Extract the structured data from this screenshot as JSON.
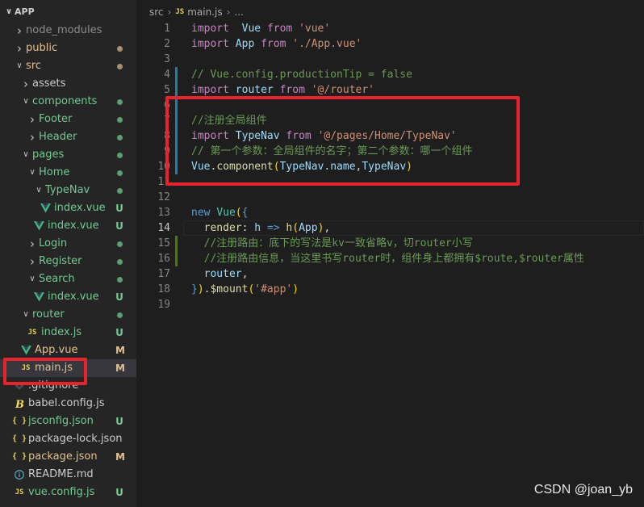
{
  "explorer": {
    "root_label": "APP",
    "items": [
      {
        "label": "node_modules",
        "kind": "folder",
        "expanded": false,
        "depth": 0,
        "color": "gray",
        "badge": ""
      },
      {
        "label": "public",
        "kind": "folder",
        "expanded": false,
        "depth": 0,
        "color": "tan",
        "badge": "dot-tan"
      },
      {
        "label": "src",
        "kind": "folder",
        "expanded": true,
        "depth": 0,
        "color": "tan",
        "badge": "dot-tan"
      },
      {
        "label": "assets",
        "kind": "folder",
        "expanded": false,
        "depth": 1,
        "color": "",
        "badge": ""
      },
      {
        "label": "components",
        "kind": "folder",
        "expanded": true,
        "depth": 1,
        "color": "green",
        "badge": "dot-green"
      },
      {
        "label": "Footer",
        "kind": "folder",
        "expanded": false,
        "depth": 2,
        "color": "green",
        "badge": "dot-green"
      },
      {
        "label": "Header",
        "kind": "folder",
        "expanded": false,
        "depth": 2,
        "color": "green",
        "badge": "dot-green"
      },
      {
        "label": "pages",
        "kind": "folder",
        "expanded": true,
        "depth": 1,
        "color": "green",
        "badge": "dot-green"
      },
      {
        "label": "Home",
        "kind": "folder",
        "expanded": true,
        "depth": 2,
        "color": "green",
        "badge": "dot-green"
      },
      {
        "label": "TypeNav",
        "kind": "folder",
        "expanded": true,
        "depth": 3,
        "color": "green",
        "badge": "dot-green"
      },
      {
        "label": "index.vue",
        "kind": "vue",
        "depth": 4,
        "color": "green",
        "badge": "U"
      },
      {
        "label": "index.vue",
        "kind": "vue",
        "depth": 3,
        "color": "green",
        "badge": "U"
      },
      {
        "label": "Login",
        "kind": "folder",
        "expanded": false,
        "depth": 2,
        "color": "green",
        "badge": "dot-green"
      },
      {
        "label": "Register",
        "kind": "folder",
        "expanded": false,
        "depth": 2,
        "color": "green",
        "badge": "dot-green"
      },
      {
        "label": "Search",
        "kind": "folder",
        "expanded": true,
        "depth": 2,
        "color": "green",
        "badge": "dot-green"
      },
      {
        "label": "index.vue",
        "kind": "vue",
        "depth": 3,
        "color": "green",
        "badge": "U"
      },
      {
        "label": "router",
        "kind": "folder",
        "expanded": true,
        "depth": 1,
        "color": "green",
        "badge": "dot-green"
      },
      {
        "label": "index.js",
        "kind": "js",
        "depth": 2,
        "color": "green",
        "badge": "U"
      },
      {
        "label": "App.vue",
        "kind": "vue",
        "depth": 1,
        "color": "tan",
        "badge": "M"
      },
      {
        "label": "main.js",
        "kind": "js",
        "depth": 1,
        "color": "tan",
        "badge": "M",
        "selected": true
      },
      {
        "label": ".gitignore",
        "kind": "git",
        "depth": 0,
        "color": "",
        "badge": ""
      },
      {
        "label": "babel.config.js",
        "kind": "babel",
        "depth": 0,
        "color": "",
        "badge": ""
      },
      {
        "label": "jsconfig.json",
        "kind": "json",
        "depth": 0,
        "color": "green",
        "badge": "U"
      },
      {
        "label": "package-lock.json",
        "kind": "json",
        "depth": 0,
        "color": "",
        "badge": ""
      },
      {
        "label": "package.json",
        "kind": "json",
        "depth": 0,
        "color": "tan",
        "badge": "M"
      },
      {
        "label": "README.md",
        "kind": "info",
        "depth": 0,
        "color": "",
        "badge": ""
      },
      {
        "label": "vue.config.js",
        "kind": "js",
        "depth": 0,
        "color": "green",
        "badge": "U"
      }
    ]
  },
  "breadcrumb": {
    "folder": "src",
    "file": "main.js",
    "tail": "...",
    "js_badge": "JS"
  },
  "editor": {
    "active_line": 14,
    "lines": [
      {
        "n": "1",
        "tokens": [
          [
            "kw",
            "import"
          ],
          [
            "",
            "  "
          ],
          [
            "var",
            "Vue"
          ],
          [
            "",
            " "
          ],
          [
            "kw",
            "from"
          ],
          [
            "",
            " "
          ],
          [
            "str",
            "'vue'"
          ]
        ]
      },
      {
        "n": "2",
        "tokens": [
          [
            "kw",
            "import"
          ],
          [
            "",
            " "
          ],
          [
            "var",
            "App"
          ],
          [
            "",
            " "
          ],
          [
            "kw",
            "from"
          ],
          [
            "",
            " "
          ],
          [
            "str",
            "'./App.vue'"
          ]
        ]
      },
      {
        "n": "3",
        "tokens": []
      },
      {
        "n": "4",
        "tokens": [
          [
            "cm",
            "// Vue.config.productionTip = false"
          ]
        ],
        "mark": "blue"
      },
      {
        "n": "5",
        "tokens": [
          [
            "kw",
            "import"
          ],
          [
            "",
            " "
          ],
          [
            "var",
            "router"
          ],
          [
            "",
            " "
          ],
          [
            "kw",
            "from"
          ],
          [
            "",
            " "
          ],
          [
            "str",
            "'@/router'"
          ]
        ],
        "mark": "blue"
      },
      {
        "n": "6",
        "tokens": [],
        "mark": "blue"
      },
      {
        "n": "7",
        "tokens": [
          [
            "cm",
            "//注册全局组件"
          ]
        ],
        "mark": "blue"
      },
      {
        "n": "8",
        "tokens": [
          [
            "kw",
            "import"
          ],
          [
            "",
            " "
          ],
          [
            "var",
            "TypeNav"
          ],
          [
            "",
            " "
          ],
          [
            "kw",
            "from"
          ],
          [
            "",
            " "
          ],
          [
            "str",
            "'@/pages/Home/TypeNav'"
          ]
        ],
        "mark": "blue"
      },
      {
        "n": "9",
        "tokens": [
          [
            "cm",
            "// 第一个参数：全局组件的名字；第二个参数：哪一个组件"
          ]
        ],
        "mark": "blue"
      },
      {
        "n": "10",
        "tokens": [
          [
            "var",
            "Vue"
          ],
          [
            "",
            "."
          ],
          [
            "fn",
            "component"
          ],
          [
            "br",
            "("
          ],
          [
            "var",
            "TypeNav"
          ],
          [
            "",
            "."
          ],
          [
            "var",
            "name"
          ],
          [
            "",
            ","
          ],
          [
            "var",
            "TypeNav"
          ],
          [
            "br",
            ")"
          ]
        ],
        "mark": "blue"
      },
      {
        "n": "11",
        "tokens": []
      },
      {
        "n": "12",
        "tokens": []
      },
      {
        "n": "13",
        "tokens": [
          [
            "kw2",
            "new"
          ],
          [
            "",
            " "
          ],
          [
            "type",
            "Vue"
          ],
          [
            "br",
            "("
          ],
          [
            "kw2",
            "{"
          ]
        ]
      },
      {
        "n": "14",
        "tokens": [
          [
            "",
            "  "
          ],
          [
            "fn",
            "render"
          ],
          [
            "",
            ": "
          ],
          [
            "var",
            "h"
          ],
          [
            "",
            " "
          ],
          [
            "kw2",
            "=>"
          ],
          [
            "",
            " "
          ],
          [
            "fn",
            "h"
          ],
          [
            "br",
            "("
          ],
          [
            "var",
            "App"
          ],
          [
            "br",
            ")"
          ],
          [
            "",
            ","
          ]
        ]
      },
      {
        "n": "15",
        "tokens": [
          [
            "",
            "  "
          ],
          [
            "cm",
            "//注册路由：底下的写法是kv一致省略v，切router小写"
          ]
        ],
        "mark": "green"
      },
      {
        "n": "16",
        "tokens": [
          [
            "",
            "  "
          ],
          [
            "cm",
            "//注册路由信息，当这里书写router时，组件身上都拥有$route,$router属性"
          ]
        ],
        "mark": "green"
      },
      {
        "n": "17",
        "tokens": [
          [
            "",
            "  "
          ],
          [
            "var",
            "router"
          ],
          [
            "",
            ","
          ]
        ]
      },
      {
        "n": "18",
        "tokens": [
          [
            "kw2",
            "}"
          ],
          [
            "br",
            ")"
          ],
          [
            "",
            "."
          ],
          [
            "fn",
            "$mount"
          ],
          [
            "br",
            "("
          ],
          [
            "str",
            "'#app'"
          ],
          [
            "br",
            ")"
          ]
        ]
      },
      {
        "n": "19",
        "tokens": []
      }
    ]
  },
  "watermark": "CSDN @joan_yb",
  "colors": {
    "highlight_box": "#e8232d",
    "untracked": "#73c991",
    "modified": "#e2c08d"
  }
}
